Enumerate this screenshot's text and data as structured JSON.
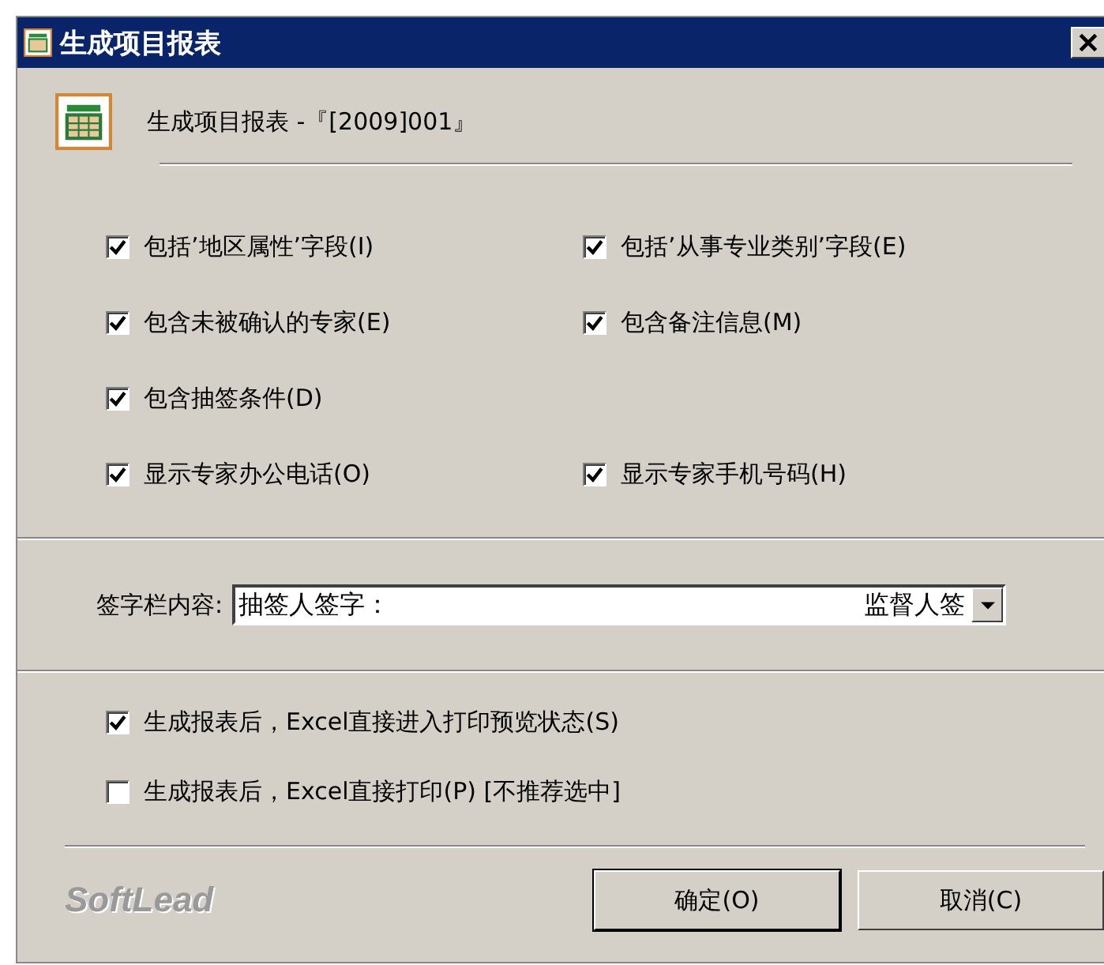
{
  "window": {
    "title": "生成项目报表"
  },
  "header": {
    "text": "生成项目报表 -『[2009]001』"
  },
  "option_rows": [
    [
      {
        "label": "包括’地区属性’字段(I)",
        "checked": true
      },
      {
        "label": "包括’从事专业类别’字段(E)",
        "checked": true
      }
    ],
    [
      {
        "label": "包含未被确认的专家(E)",
        "checked": true
      },
      {
        "label": "包含备注信息(M)",
        "checked": true
      }
    ],
    [
      {
        "label": "包含抽签条件(D)",
        "checked": true
      }
    ],
    [
      {
        "label": "显示专家办公电话(O)",
        "checked": true
      },
      {
        "label": "显示专家手机号码(H)",
        "checked": true
      }
    ]
  ],
  "signature": {
    "label": "签字栏内容:",
    "value_left": "抽签人签字：",
    "value_right": "监督人签"
  },
  "print_options": [
    {
      "label": "生成报表后，Excel直接进入打印预览状态(S)",
      "checked": true
    },
    {
      "label": "生成报表后，Excel直接打印(P) [不推荐选中]",
      "checked": false
    }
  ],
  "footer": {
    "brand": "SoftLead",
    "buttons": [
      {
        "label": "确定(O)",
        "selected": true
      },
      {
        "label": "取消(C)",
        "selected": false
      }
    ]
  }
}
